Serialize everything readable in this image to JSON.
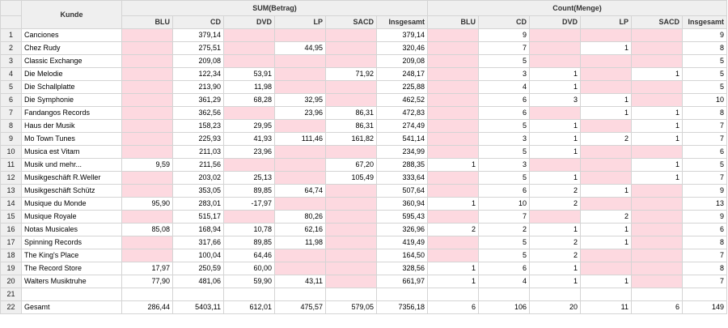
{
  "header": {
    "kunde": "Kunde",
    "sum_group": "SUM(Betrag)",
    "count_group": "Count(Menge)",
    "sum_cols": [
      "BLU",
      "CD",
      "DVD",
      "LP",
      "SACD",
      "Insgesamt"
    ],
    "count_cols": [
      "BLU",
      "CD",
      "DVD",
      "LP",
      "SACD",
      "Insgesamt"
    ]
  },
  "colors": {
    "empty_cell": "#fdd9e0",
    "header_bg": "#efefef",
    "grid": "#d4d4d4"
  },
  "rows": [
    {
      "n": "1",
      "name": "Canciones",
      "sum": [
        "",
        "379,14",
        "",
        "",
        "",
        "379,14"
      ],
      "cnt": [
        "",
        "9",
        "",
        "",
        "",
        "9"
      ]
    },
    {
      "n": "2",
      "name": "Chez Rudy",
      "sum": [
        "",
        "275,51",
        "",
        "44,95",
        "",
        "320,46"
      ],
      "cnt": [
        "",
        "7",
        "",
        "1",
        "",
        "8"
      ]
    },
    {
      "n": "3",
      "name": "Classic Exchange",
      "sum": [
        "",
        "209,08",
        "",
        "",
        "",
        "209,08"
      ],
      "cnt": [
        "",
        "5",
        "",
        "",
        "",
        "5"
      ]
    },
    {
      "n": "4",
      "name": "Die Melodie",
      "sum": [
        "",
        "122,34",
        "53,91",
        "",
        "71,92",
        "248,17"
      ],
      "cnt": [
        "",
        "3",
        "1",
        "",
        "1",
        "5"
      ]
    },
    {
      "n": "5",
      "name": "Die Schallplatte",
      "sum": [
        "",
        "213,90",
        "11,98",
        "",
        "",
        "225,88"
      ],
      "cnt": [
        "",
        "4",
        "1",
        "",
        "",
        "5"
      ]
    },
    {
      "n": "6",
      "name": "Die Symphonie",
      "sum": [
        "",
        "361,29",
        "68,28",
        "32,95",
        "",
        "462,52"
      ],
      "cnt": [
        "",
        "6",
        "3",
        "1",
        "",
        "10"
      ]
    },
    {
      "n": "7",
      "name": "Fandangos Records",
      "sum": [
        "",
        "362,56",
        "",
        "23,96",
        "86,31",
        "472,83"
      ],
      "cnt": [
        "",
        "6",
        "",
        "1",
        "1",
        "8"
      ]
    },
    {
      "n": "8",
      "name": "Haus der Musik",
      "sum": [
        "",
        "158,23",
        "29,95",
        "",
        "86,31",
        "274,49"
      ],
      "cnt": [
        "",
        "5",
        "1",
        "",
        "1",
        "7"
      ]
    },
    {
      "n": "9",
      "name": "Mo Town Tunes",
      "sum": [
        "",
        "225,93",
        "41,93",
        "111,46",
        "161,82",
        "541,14"
      ],
      "cnt": [
        "",
        "3",
        "1",
        "2",
        "1",
        "7"
      ]
    },
    {
      "n": "10",
      "name": "Musica est Vitam",
      "sum": [
        "",
        "211,03",
        "23,96",
        "",
        "",
        "234,99"
      ],
      "cnt": [
        "",
        "5",
        "1",
        "",
        "",
        "6"
      ]
    },
    {
      "n": "11",
      "name": "Musik und mehr...",
      "sum": [
        "9,59",
        "211,56",
        "",
        "",
        "67,20",
        "288,35"
      ],
      "cnt": [
        "1",
        "3",
        "",
        "",
        "1",
        "5"
      ]
    },
    {
      "n": "12",
      "name": "Musikgeschäft R.Weller",
      "sum": [
        "",
        "203,02",
        "25,13",
        "",
        "105,49",
        "333,64"
      ],
      "cnt": [
        "",
        "5",
        "1",
        "",
        "1",
        "7"
      ]
    },
    {
      "n": "13",
      "name": "Musikgeschäft Schütz",
      "sum": [
        "",
        "353,05",
        "89,85",
        "64,74",
        "",
        "507,64"
      ],
      "cnt": [
        "",
        "6",
        "2",
        "1",
        "",
        "9"
      ]
    },
    {
      "n": "14",
      "name": "Musique du Monde",
      "sum": [
        "95,90",
        "283,01",
        "-17,97",
        "",
        "",
        "360,94"
      ],
      "cnt": [
        "1",
        "10",
        "2",
        "",
        "",
        "13"
      ]
    },
    {
      "n": "15",
      "name": "Musique Royale",
      "sum": [
        "",
        "515,17",
        "",
        "80,26",
        "",
        "595,43"
      ],
      "cnt": [
        "",
        "7",
        "",
        "2",
        "",
        "9"
      ]
    },
    {
      "n": "16",
      "name": "Notas Musicales",
      "sum": [
        "85,08",
        "168,94",
        "10,78",
        "62,16",
        "",
        "326,96"
      ],
      "cnt": [
        "2",
        "2",
        "1",
        "1",
        "",
        "6"
      ]
    },
    {
      "n": "17",
      "name": "Spinning Records",
      "sum": [
        "",
        "317,66",
        "89,85",
        "11,98",
        "",
        "419,49"
      ],
      "cnt": [
        "",
        "5",
        "2",
        "1",
        "",
        "8"
      ]
    },
    {
      "n": "18",
      "name": "The King's Place",
      "sum": [
        "",
        "100,04",
        "64,46",
        "",
        "",
        "164,50"
      ],
      "cnt": [
        "",
        "5",
        "2",
        "",
        "",
        "7"
      ]
    },
    {
      "n": "19",
      "name": "The Record Store",
      "sum": [
        "17,97",
        "250,59",
        "60,00",
        "",
        "",
        "328,56"
      ],
      "cnt": [
        "1",
        "6",
        "1",
        "",
        "",
        "8"
      ]
    },
    {
      "n": "20",
      "name": "Walters Musiktruhe",
      "sum": [
        "77,90",
        "481,06",
        "59,90",
        "43,11",
        "",
        "661,97"
      ],
      "cnt": [
        "1",
        "4",
        "1",
        "1",
        "",
        "7"
      ]
    }
  ],
  "blank_row": {
    "n": "21"
  },
  "total": {
    "n": "22",
    "name": "Gesamt",
    "sum": [
      "286,44",
      "5403,11",
      "612,01",
      "475,57",
      "579,05",
      "7356,18"
    ],
    "cnt": [
      "6",
      "106",
      "20",
      "11",
      "6",
      "149"
    ]
  }
}
